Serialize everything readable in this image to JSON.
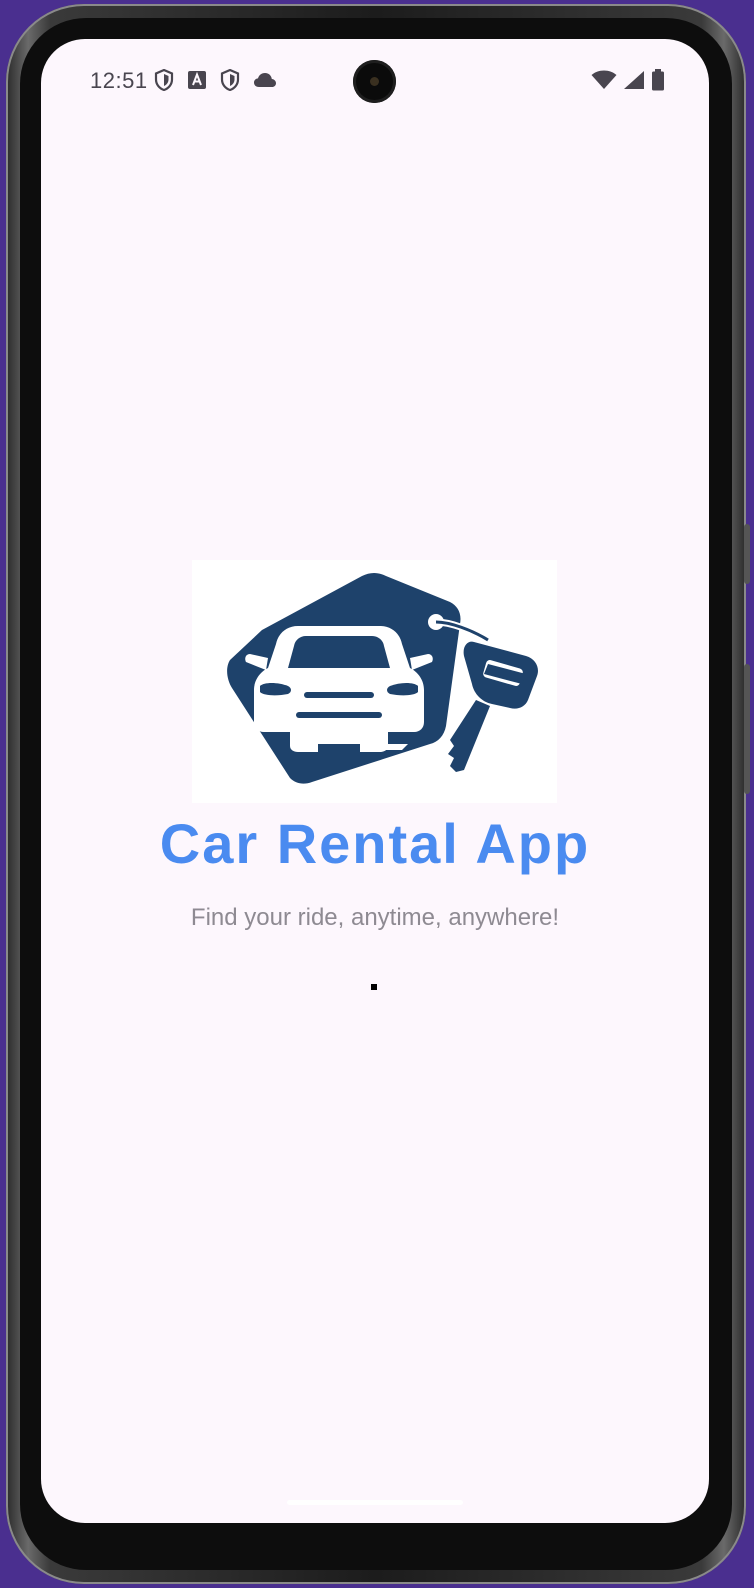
{
  "status_bar": {
    "time": "12:51",
    "left_icons": [
      "shield-icon",
      "font-a-icon",
      "shield-icon",
      "cloud-icon"
    ],
    "right_icons": [
      "wifi-icon",
      "cellular-signal-icon",
      "battery-icon"
    ]
  },
  "splash": {
    "logo_alt": "car-rental-logo",
    "title": "Car Rental App",
    "subtitle": "Find your ride, anytime, anywhere!",
    "loading": true
  },
  "colors": {
    "title": "#4a8bf0",
    "subtitle": "#8e8a92",
    "logo_primary": "#1e426b",
    "screen_background": "#fdf7fd",
    "wallpaper": "#4a2f8f"
  }
}
